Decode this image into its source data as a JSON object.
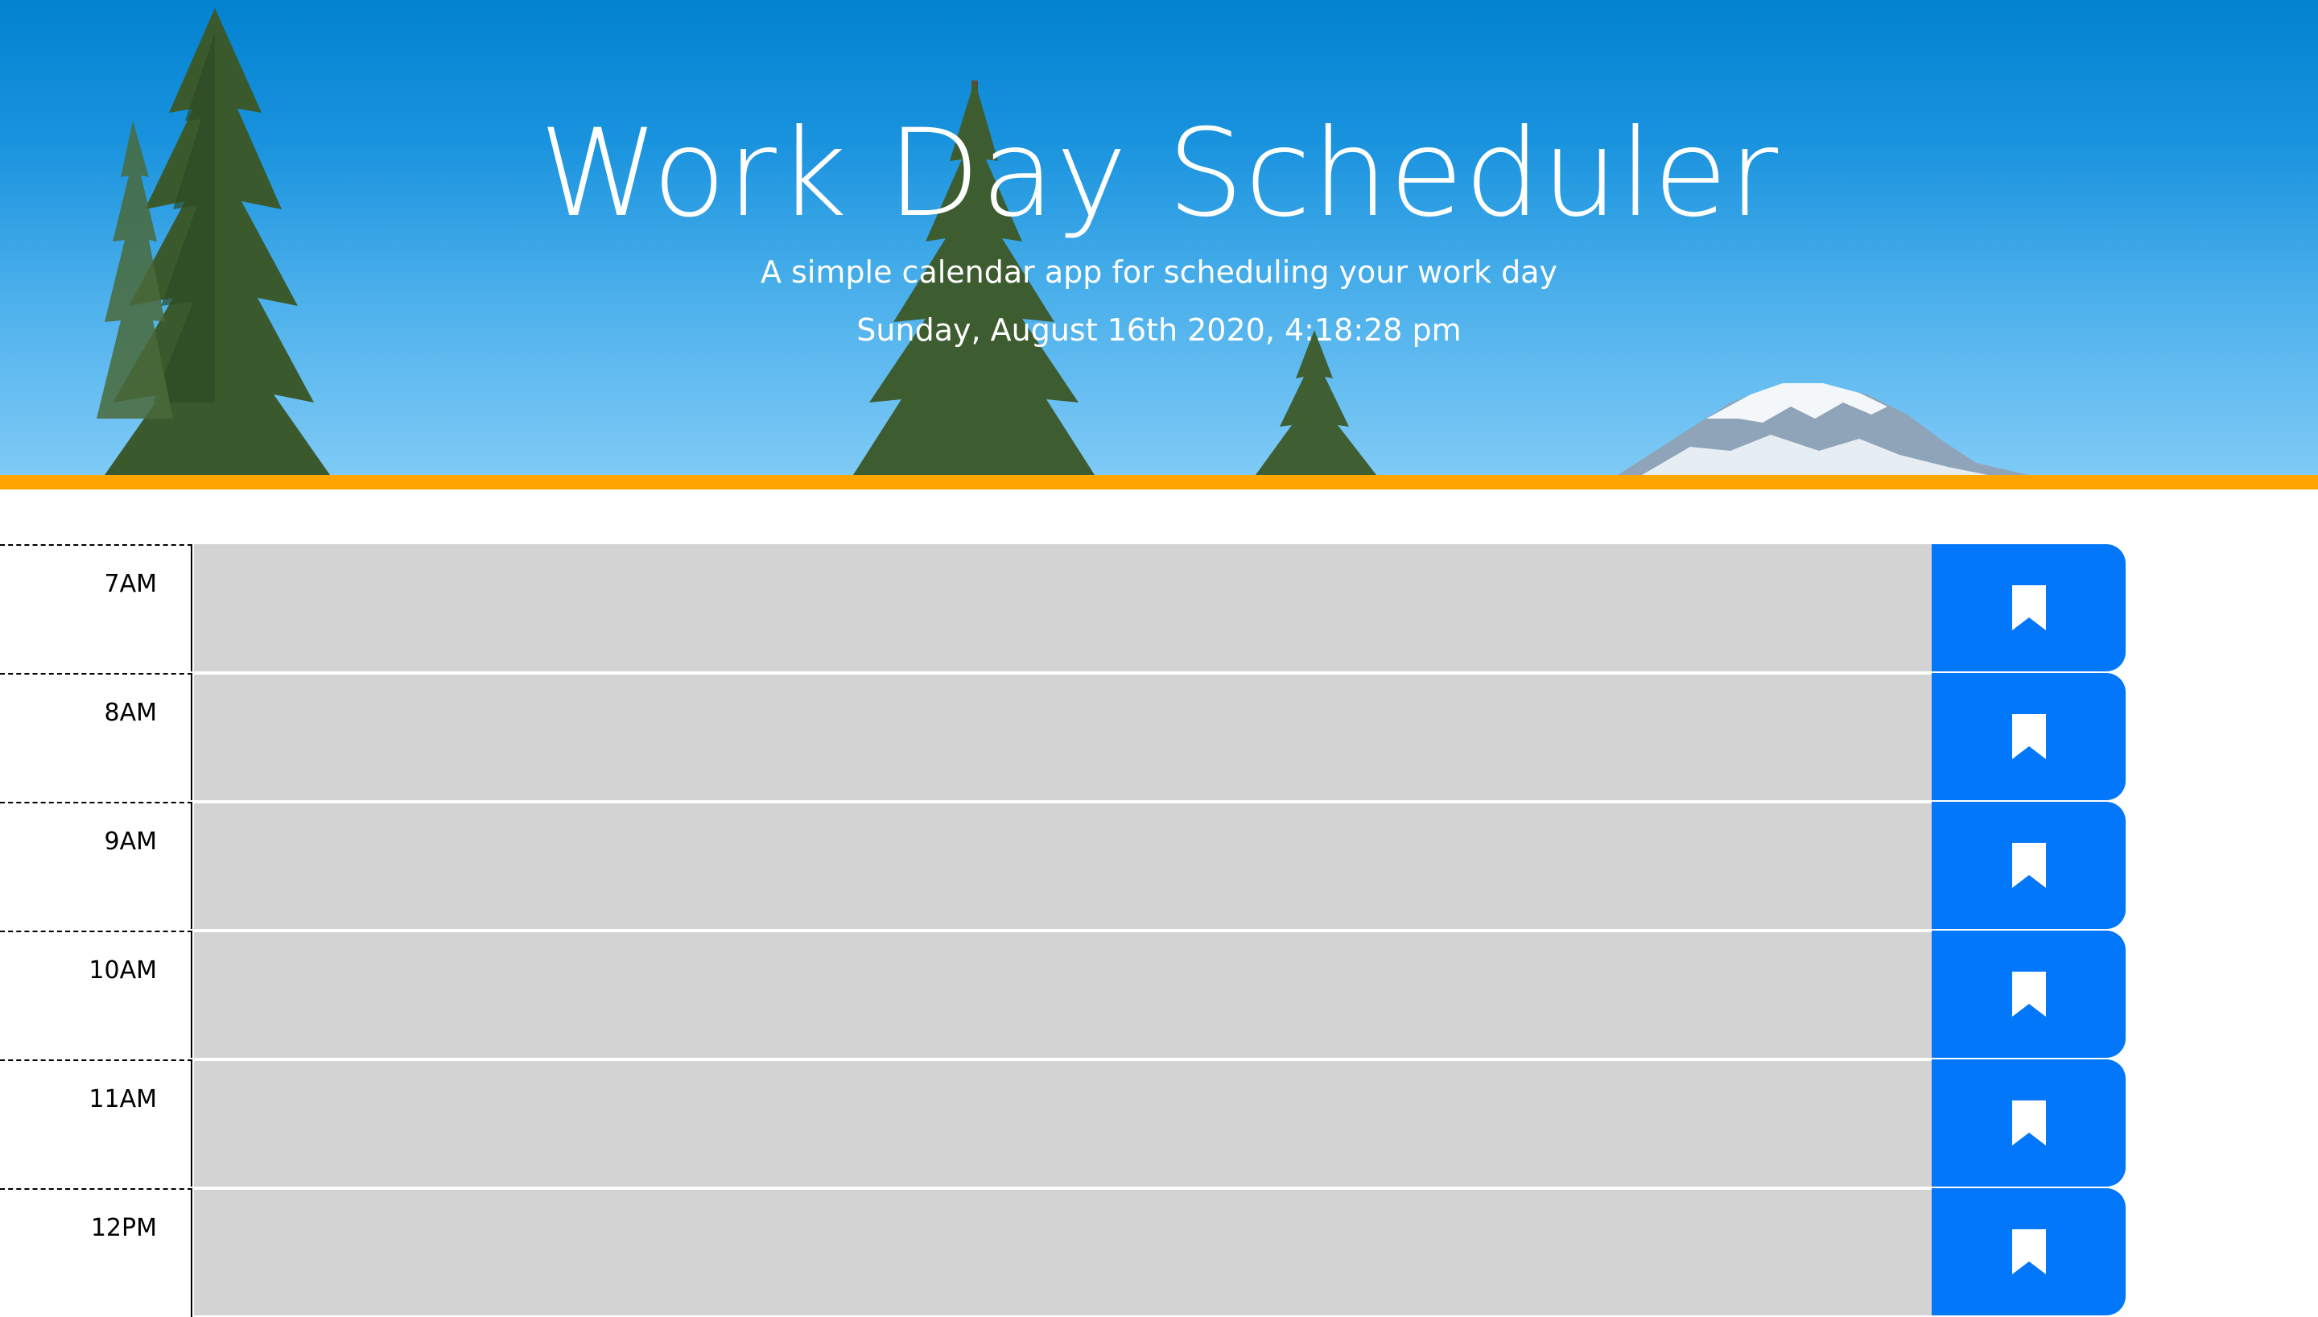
{
  "header": {
    "title": "Work Day Scheduler",
    "subtitle": "A simple calendar app for scheduling your work day",
    "current_datetime": "Sunday, August 16th 2020, 4:18:28 pm"
  },
  "colors": {
    "accent_bar": "#ffa500",
    "time_block_past": "#d3d3d3",
    "save_button": "#0277fa"
  },
  "save_icon": "bookmark-icon",
  "time_blocks": [
    {
      "hour": "7AM",
      "task": ""
    },
    {
      "hour": "8AM",
      "task": ""
    },
    {
      "hour": "9AM",
      "task": ""
    },
    {
      "hour": "10AM",
      "task": ""
    },
    {
      "hour": "11AM",
      "task": ""
    },
    {
      "hour": "12PM",
      "task": ""
    }
  ]
}
